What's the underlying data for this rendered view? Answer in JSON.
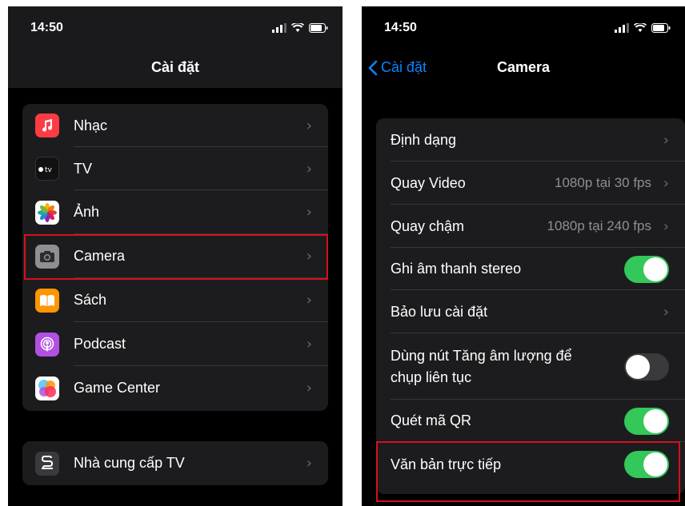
{
  "left_screen": {
    "status_time": "14:50",
    "title": "Cài đặt",
    "group1": [
      {
        "label": "Nhạc",
        "icon": "music-icon",
        "color": "#fc3c44"
      },
      {
        "label": "TV",
        "icon": "apple-tv-icon",
        "color": "#111111"
      },
      {
        "label": "Ảnh",
        "icon": "photos-icon",
        "color": "#ffffff"
      },
      {
        "label": "Camera",
        "icon": "camera-icon",
        "color": "#8e8e93"
      },
      {
        "label": "Sách",
        "icon": "books-icon",
        "color": "#ff9500"
      },
      {
        "label": "Podcast",
        "icon": "podcast-icon",
        "color": "#b150e2"
      },
      {
        "label": "Game Center",
        "icon": "game-center-icon",
        "color": "#ffffff"
      }
    ],
    "group2": [
      {
        "label": "Nhà cung cấp TV",
        "icon": "tv-provider-icon",
        "color": "#3a3a3c"
      }
    ],
    "highlighted_item": "Camera"
  },
  "right_screen": {
    "status_time": "14:50",
    "back_label": "Cài đặt",
    "title": "Camera",
    "rows": [
      {
        "label": "Định dạng",
        "type": "chevron"
      },
      {
        "label": "Quay Video",
        "type": "value",
        "value": "1080p tại 30 fps"
      },
      {
        "label": "Quay chậm",
        "type": "value",
        "value": "1080p tại 240 fps"
      },
      {
        "label": "Ghi âm thanh stereo",
        "type": "toggle",
        "on": true
      },
      {
        "label": "Bảo lưu cài đặt",
        "type": "chevron"
      },
      {
        "label_line1": "Dùng nút Tăng âm lượng để",
        "label_line2": "chụp liên tục",
        "type": "toggle",
        "on": false
      },
      {
        "label": "Quét mã QR",
        "type": "toggle",
        "on": true
      },
      {
        "label": "Văn bản trực tiếp",
        "type": "toggle",
        "on": true
      }
    ],
    "highlighted_item": "Văn bản trực tiếp"
  },
  "colors": {
    "toggle_on": "#34c759",
    "highlight": "#d0121b",
    "accent": "#0a84ff"
  }
}
